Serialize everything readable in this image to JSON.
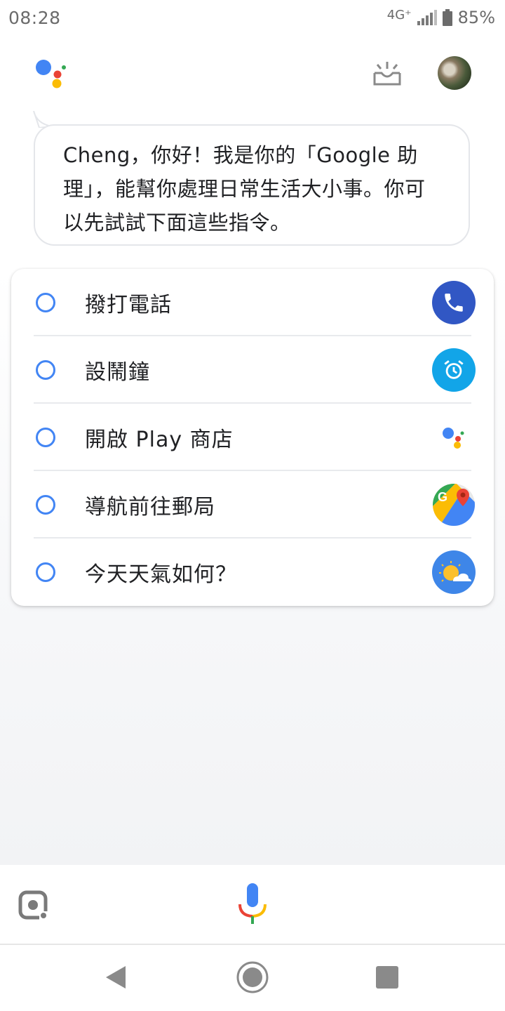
{
  "status_bar": {
    "time": "08:28",
    "network": "4G⁺",
    "battery": "85%"
  },
  "greeting": {
    "text": "Cheng，你好！我是你的「Google 助理」，能幫你處理日常生活大小事。你可以先試試下面這些指令。"
  },
  "suggestions": [
    {
      "label": "撥打電話",
      "icon": "phone-icon",
      "color": "#3157c4"
    },
    {
      "label": "設鬧鐘",
      "icon": "alarm-clock-icon",
      "color": "#12a5e8"
    },
    {
      "label": "開啟 Play 商店",
      "icon": "google-assistant-icon",
      "color": "#ffffff"
    },
    {
      "label": "導航前往郵局",
      "icon": "google-maps-icon",
      "color": "#ffffff"
    },
    {
      "label": "今天天氣如何？",
      "icon": "weather-icon",
      "color": "#3e86e8"
    }
  ],
  "colors": {
    "google_blue": "#4285f4",
    "google_red": "#ea4335",
    "google_yellow": "#fbbc05",
    "google_green": "#34a853"
  }
}
